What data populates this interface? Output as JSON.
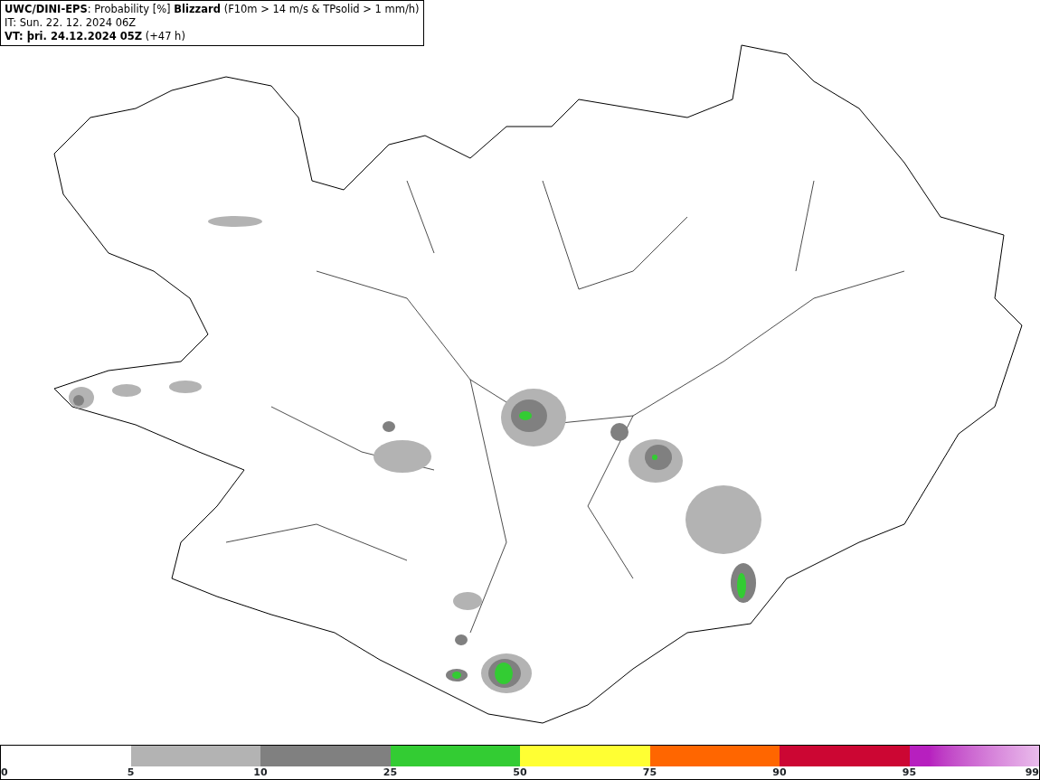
{
  "header": {
    "lines": [
      "**UWC/DINI-EPS**: Probability [%] **Blizzard** (F10m > 14 m/s & TPsolid > 1 mm/h)",
      "IT: Sun. 22. 12. 2024 06Z",
      "**VT: þri. 24.12.2024 05Z** (+47 h)"
    ]
  },
  "legend": {
    "bins": [
      {
        "color": "#b3b3b3"
      },
      {
        "color": "#808080"
      },
      {
        "color": "#33cc33"
      },
      {
        "color": "#ffff33"
      },
      {
        "color": "#ff6600"
      },
      {
        "color": "#cc0633"
      },
      {
        "color": "#b71fbf",
        "kind": "gradient"
      }
    ],
    "ticks": [
      "0",
      "5",
      "10",
      "25",
      "50",
      "75",
      "90",
      "95",
      "99"
    ]
  }
}
